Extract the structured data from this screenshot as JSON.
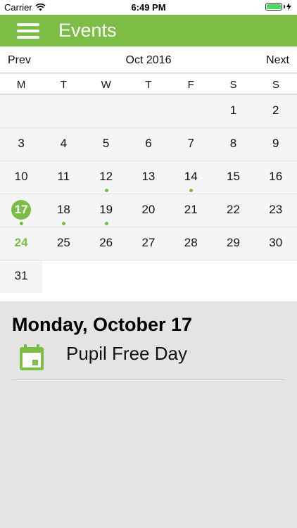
{
  "status_bar": {
    "carrier": "Carrier",
    "time": "6:49 PM",
    "battery_level": 1.0
  },
  "navbar": {
    "title": "Events",
    "menu_icon": "hamburger-menu-icon"
  },
  "calendar": {
    "prev_label": "Prev",
    "month_title": "Oct 2016",
    "next_label": "Next",
    "weekdays": [
      "M",
      "T",
      "W",
      "T",
      "F",
      "S",
      "S"
    ],
    "weeks": [
      [
        "",
        "",
        "",
        "",
        "",
        "1",
        "2"
      ],
      [
        "3",
        "4",
        "5",
        "6",
        "7",
        "8",
        "9"
      ],
      [
        "10",
        "11",
        "12",
        "13",
        "14",
        "15",
        "16"
      ],
      [
        "17",
        "18",
        "19",
        "20",
        "21",
        "22",
        "23"
      ],
      [
        "24",
        "25",
        "26",
        "27",
        "28",
        "29",
        "30"
      ],
      [
        "31"
      ]
    ],
    "selected_day": "17",
    "highlighted_day": "24",
    "event_days": [
      "12",
      "14",
      "17",
      "18",
      "19"
    ]
  },
  "events": {
    "heading": "Monday, October 17",
    "items": [
      {
        "title": "Pupil Free Day",
        "icon": "calendar-icon"
      }
    ]
  },
  "colors": {
    "accent": "#7cbd45"
  }
}
